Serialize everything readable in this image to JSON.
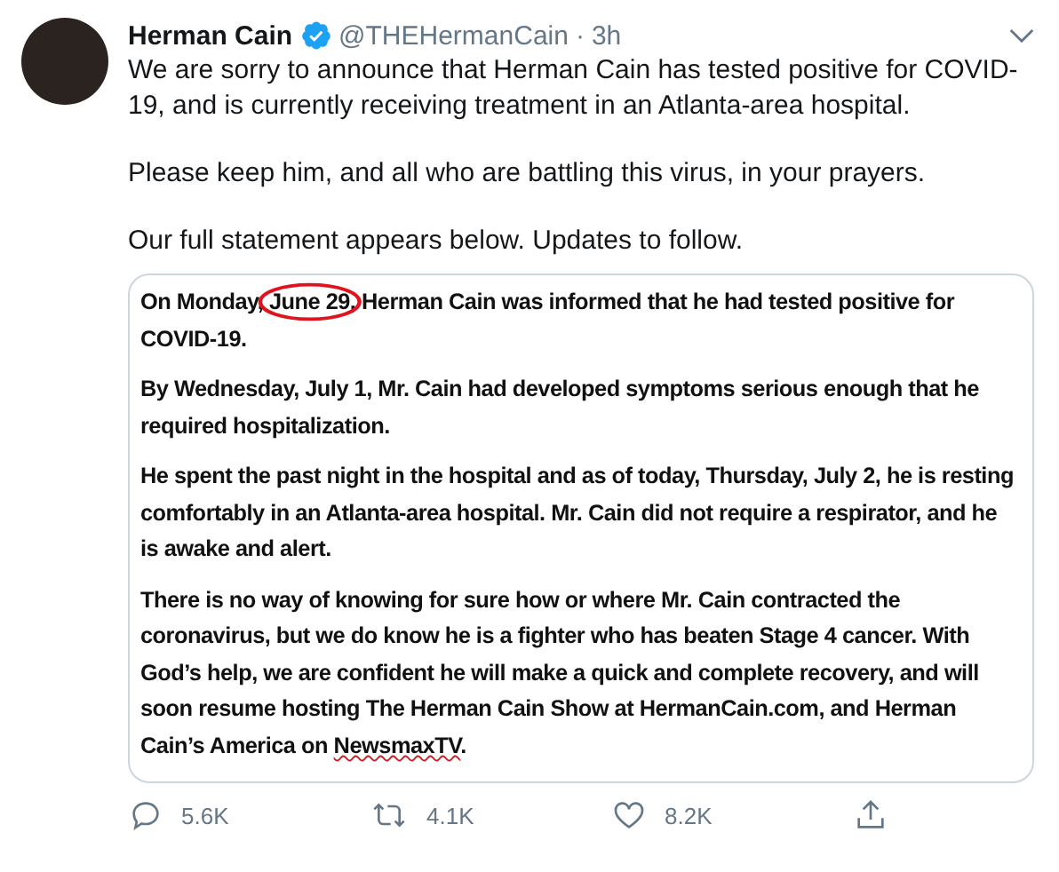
{
  "tweet": {
    "author": {
      "name": "Herman Cain",
      "verified": true,
      "handle": "@THEHermanCain",
      "separator": "·",
      "time": "3h"
    },
    "paragraphs": [
      "We are sorry to announce that Herman Cain has tested positive for COVID-19, and is currently receiving treatment in an Atlanta-area hospital.",
      "Please keep him, and all who are battling this virus, in your prayers.",
      "Our full statement appears below. Updates to follow."
    ],
    "statement": {
      "paragraphs": [
        [
          {
            "text": "On Monday, "
          },
          {
            "text": "June 29,",
            "circled": true
          },
          {
            "text": " Herman Cain was informed that he had tested positive for COVID-19."
          }
        ],
        [
          {
            "text": "By Wednesday, July 1, Mr. Cain had developed symptoms serious enough that he required hospitalization."
          }
        ],
        [
          {
            "text": "He spent the past night in the hospital and as of today, Thursday, July 2, he is resting comfortably in an Atlanta-area hospital. Mr. Cain did not require a respirator, and he is awake and alert."
          }
        ],
        [
          {
            "text": "There is no way of knowing for sure how or where Mr. Cain contracted the coronavirus, but we do know he is a fighter who has beaten Stage 4 cancer. With God’s help, we are confident he will make a quick and complete recovery, and will soon resume hosting The Herman Cain Show at HermanCain.com, and Herman Cain’s America on "
          },
          {
            "text": "NewsmaxTV",
            "misspelled": true
          },
          {
            "text": "."
          }
        ]
      ]
    },
    "actions": [
      {
        "kind": "reply",
        "count": "5.6K"
      },
      {
        "kind": "retweet",
        "count": "4.1K"
      },
      {
        "kind": "like",
        "count": "8.2K"
      },
      {
        "kind": "share"
      }
    ]
  }
}
